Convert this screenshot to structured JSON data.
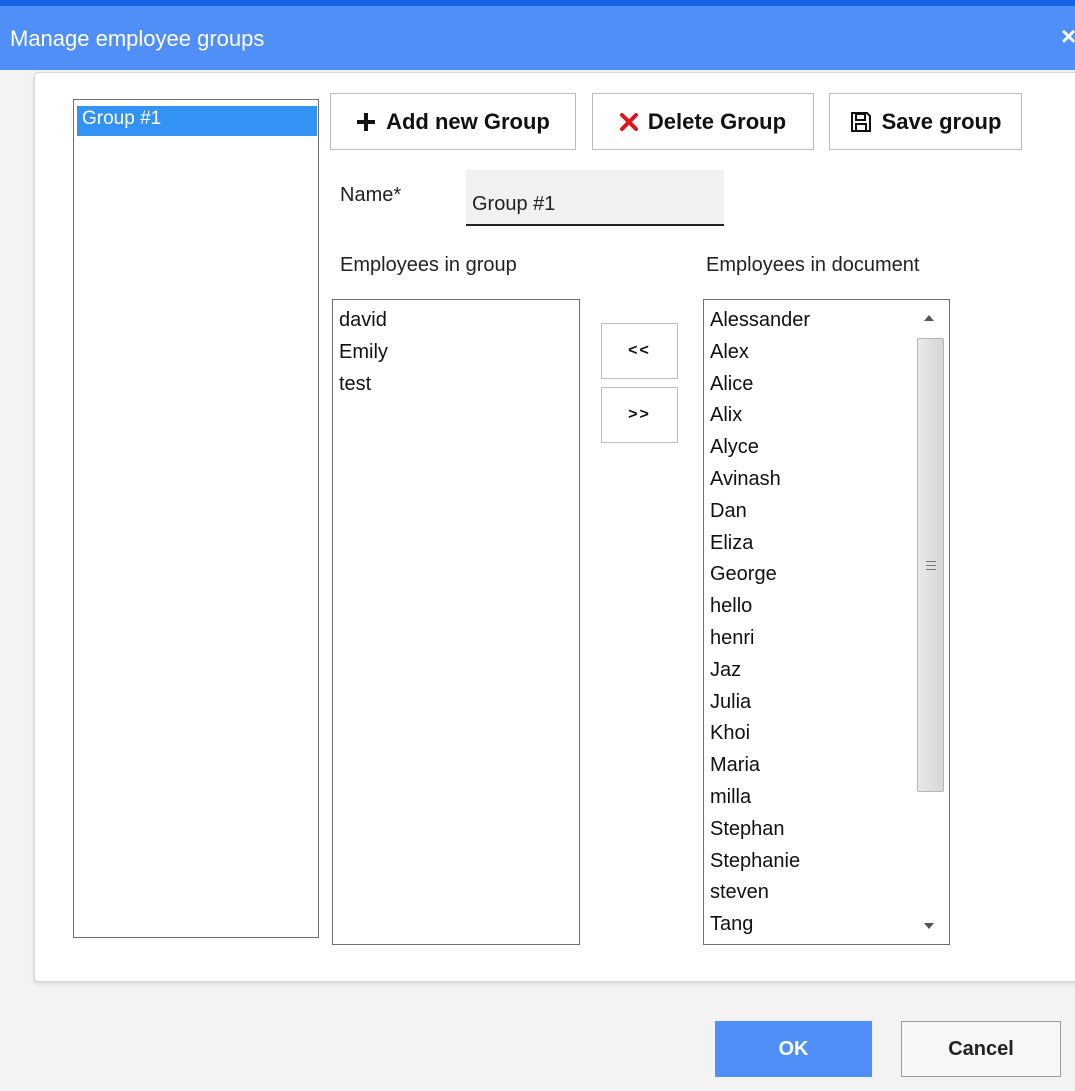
{
  "window": {
    "title": "Manage employee groups",
    "close_icon": "×"
  },
  "groups": {
    "items": [
      "Group #1"
    ],
    "selected": "Group #1"
  },
  "toolbar": {
    "add_label": "Add new Group",
    "delete_label": "Delete Group",
    "save_label": "Save group"
  },
  "form": {
    "name_label": "Name*",
    "name_value": "Group #1"
  },
  "group_members": {
    "heading": "Employees in group",
    "items": [
      "david",
      "Emily",
      "test"
    ]
  },
  "document_employees": {
    "heading": "Employees in document",
    "items": [
      "Alessander",
      "Alex",
      "Alice",
      "Alix",
      "Alyce",
      "Avinash",
      "Dan",
      "Eliza",
      "George",
      "hello",
      "henri",
      "Jaz",
      "Julia",
      "Khoi",
      "Maria",
      "milla",
      "Stephan",
      "Stephanie",
      "steven",
      "Tang"
    ]
  },
  "move": {
    "to_group_label": "<<",
    "to_document_label": ">>"
  },
  "footer": {
    "ok_label": "OK",
    "cancel_label": "Cancel"
  },
  "colors": {
    "title_bar": "#4f8ff7",
    "selection": "#3393f4",
    "delete_icon": "#e0141e"
  },
  "icons": {
    "add": "plus-icon",
    "delete": "x-icon",
    "save": "floppy-disk-icon",
    "close": "close-icon"
  }
}
